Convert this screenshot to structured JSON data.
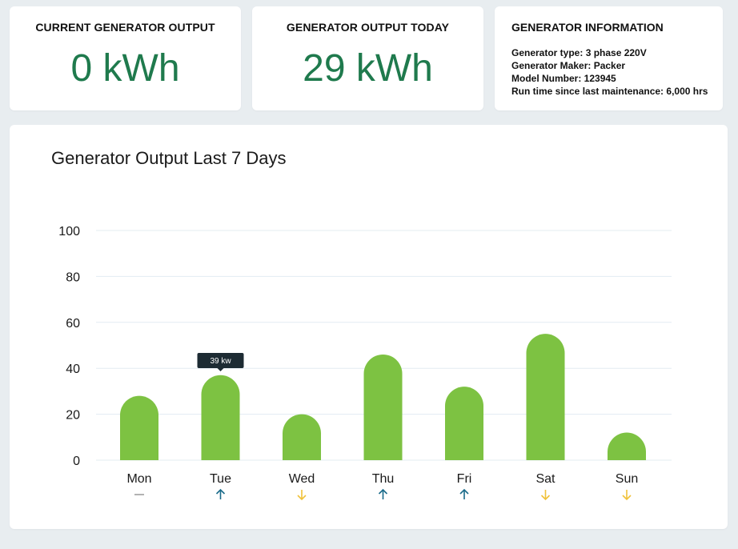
{
  "cards": {
    "current": {
      "title": "CURRENT GENERATOR OUTPUT",
      "value": "0 kWh"
    },
    "today": {
      "title": "GENERATOR OUTPUT TODAY",
      "value": "29 kWh"
    },
    "info": {
      "title": "GENERATOR INFORMATION",
      "lines": [
        "Generator type: 3 phase 220V",
        "Generator Maker: Packer",
        "Model Number: 123945",
        "Run time since last maintenance: 6,000 hrs"
      ]
    }
  },
  "colors": {
    "accent": "#1f7a4d",
    "bar": "#7dc242",
    "trend_up": "#1a6b8a",
    "trend_down": "#f0c23a",
    "trend_flat": "#999999",
    "tooltip_bg": "#1d2b33"
  },
  "chart_data": {
    "type": "bar",
    "title": "Generator Output Last 7 Days",
    "categories": [
      "Mon",
      "Tue",
      "Wed",
      "Thu",
      "Fri",
      "Sat",
      "Sun"
    ],
    "values": [
      28,
      37,
      20,
      46,
      32,
      55,
      12
    ],
    "yticks": [
      0,
      20,
      40,
      60,
      80,
      100
    ],
    "ylim": [
      0,
      100
    ],
    "trends": [
      "flat",
      "up",
      "down",
      "up",
      "up",
      "down",
      "down"
    ],
    "tooltip": {
      "category_index": 1,
      "text": "39 kw"
    },
    "grid": true,
    "xlabel": "",
    "ylabel": ""
  }
}
